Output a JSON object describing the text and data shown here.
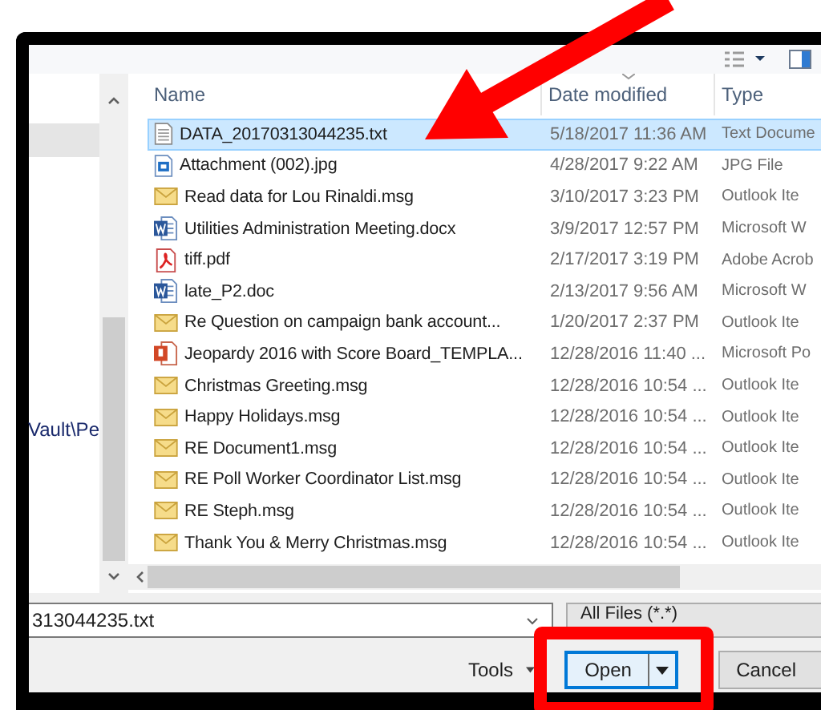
{
  "file_list": {
    "columns": [
      "Name",
      "Date modified",
      "Type"
    ],
    "rows": [
      {
        "name": "DATA_20170313044235.txt",
        "date": "5/18/2017 11:36 AM",
        "type": "Text Docume",
        "kind": "text",
        "selected": true
      },
      {
        "name": "Attachment (002).jpg",
        "date": "4/28/2017 9:22 AM",
        "type": "JPG File",
        "kind": "image",
        "selected": false
      },
      {
        "name": "Read  data for Lou Rinaldi.msg",
        "date": "3/10/2017 3:23 PM",
        "type": "Outlook Ite",
        "kind": "mail",
        "selected": false
      },
      {
        "name": "Utilities Administration Meeting.docx",
        "date": "3/9/2017 12:57 PM",
        "type": "Microsoft W",
        "kind": "word",
        "selected": false
      },
      {
        "name": "tiff.pdf",
        "date": "2/17/2017 3:19 PM",
        "type": "Adobe Acrob",
        "kind": "pdf",
        "selected": false
      },
      {
        "name": "late_P2.doc",
        "date": "2/13/2017 9:56 AM",
        "type": "Microsoft W",
        "kind": "word",
        "selected": false
      },
      {
        "name": "Re  Question on campaign bank account...",
        "date": "1/20/2017 2:37 PM",
        "type": "Outlook Ite",
        "kind": "mail",
        "selected": false
      },
      {
        "name": "Jeopardy 2016 with Score Board_TEMPLA...",
        "date": "12/28/2016 11:40 ...",
        "type": "Microsoft Po",
        "kind": "powerpoint",
        "selected": false
      },
      {
        "name": "Christmas Greeting.msg",
        "date": "12/28/2016 10:54 ...",
        "type": "Outlook Ite",
        "kind": "mail",
        "selected": false
      },
      {
        "name": "Happy Holidays.msg",
        "date": "12/28/2016 10:54 ...",
        "type": "Outlook Ite",
        "kind": "mail",
        "selected": false
      },
      {
        "name": "RE  Document1.msg",
        "date": "12/28/2016 10:54 ...",
        "type": "Outlook Ite",
        "kind": "mail",
        "selected": false
      },
      {
        "name": "RE  Poll Worker Coordinator List.msg",
        "date": "12/28/2016 10:54 ...",
        "type": "Outlook Ite",
        "kind": "mail",
        "selected": false
      },
      {
        "name": "RE  Steph.msg",
        "date": "12/28/2016 10:54 ...",
        "type": "Outlook Ite",
        "kind": "mail",
        "selected": false
      },
      {
        "name": "Thank You & Merry Christmas.msg",
        "date": "12/28/2016 10:54 ...",
        "type": "Outlook Ite",
        "kind": "mail",
        "selected": false
      }
    ]
  },
  "nav_pane": {
    "path_text": "Vault\\Pe"
  },
  "file_name_field": {
    "value": "313044235.txt"
  },
  "file_type_filter": {
    "value": "All Files (*.*)"
  },
  "buttons": {
    "tools": "Tools",
    "open": "Open",
    "cancel": "Cancel"
  }
}
